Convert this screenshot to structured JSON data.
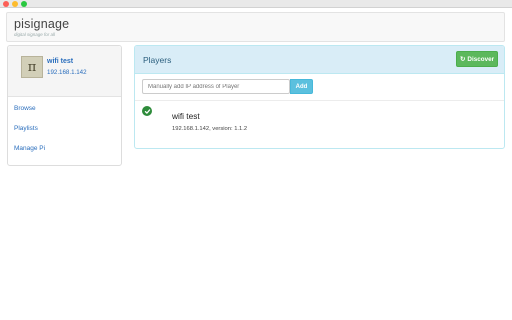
{
  "window": {
    "controls": [
      "close",
      "minimize",
      "zoom"
    ]
  },
  "header": {
    "brand": "pisignage",
    "tagline": "digital signage for all"
  },
  "sidebar": {
    "profile": {
      "avatar_glyph": "π",
      "name": "wifi test",
      "ip": "192.168.1.142"
    },
    "items": [
      {
        "label": "Browse"
      },
      {
        "label": "Playlists"
      },
      {
        "label": "Manage Pi"
      }
    ]
  },
  "players_panel": {
    "title": "Players",
    "discover_label": "Discover",
    "discover_icon": "refresh-icon",
    "ip_input": {
      "placeholder": "Manually add IP address of Player",
      "value": ""
    },
    "add_label": "Add",
    "players": [
      {
        "name": "wifi test",
        "details": "192.168.1.142, version: 1.1.2",
        "status": "online",
        "status_color": "#2e8b3a"
      }
    ]
  },
  "colors": {
    "link": "#2a6ebd",
    "panel_header": "#d9edf7",
    "discover_button": "#5cb85c",
    "add_button": "#5bc0de"
  }
}
